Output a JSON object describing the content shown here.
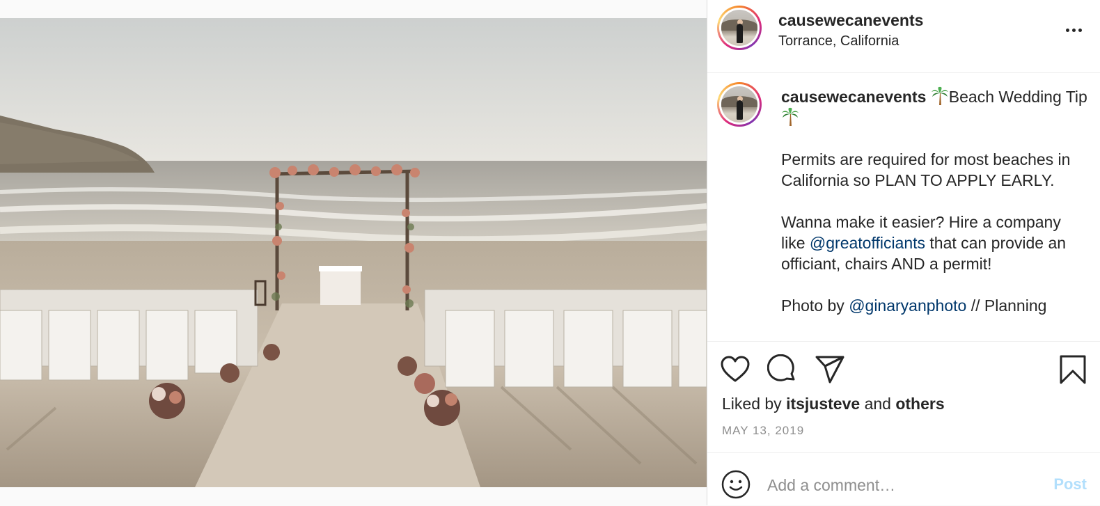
{
  "post": {
    "author": "causewecanevents",
    "location": "Torrance, California"
  },
  "caption": {
    "username": "causewecanevents",
    "title_line_1": "Beach",
    "title_line_2": "Wedding Tip",
    "para1": "Permits are required for most beaches in California so PLAN TO APPLY EARLY.",
    "para2_pre": "Wanna make it easier? Hire a company like",
    "para2_mention": "@greatofficiants",
    "para2_post": "that can provide an officiant, chairs AND a permit!",
    "para3_pre": "Photo by",
    "para3_mention": "@ginaryanphoto",
    "para3_post": "// Planning"
  },
  "likes": {
    "prefix": "Liked by",
    "user": "itsjusteve",
    "conjunction": "and",
    "others": "others"
  },
  "date": "MAY 13, 2019",
  "comment": {
    "placeholder": "Add a comment…",
    "post_label": "Post"
  },
  "icons": {
    "more": "more-icon",
    "like": "heart-icon",
    "comment": "comment-icon",
    "share": "paper-plane-icon",
    "save": "bookmark-icon",
    "emoji": "smiley-icon",
    "palm": "palm-tree-emoji"
  },
  "colors": {
    "mention": "#00376b",
    "post_button_disabled": "#b2dffc",
    "muted": "#8e8e8e",
    "text": "#262626"
  }
}
